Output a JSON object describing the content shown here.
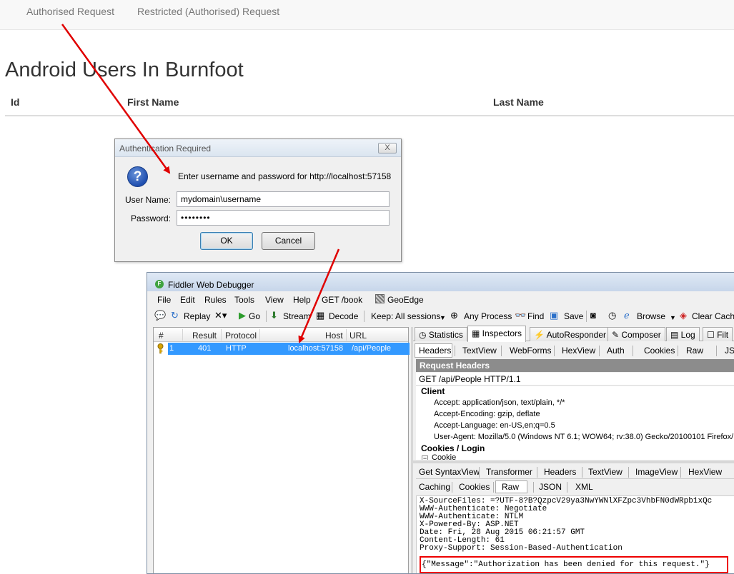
{
  "web": {
    "nav_links": [
      "Authorised Request",
      "Restricted (Authorised) Request"
    ],
    "page_title": "Android Users In Burnfoot",
    "table_headers": [
      "Id",
      "First Name",
      "Last Name"
    ]
  },
  "dialog": {
    "title": "Authentication Required",
    "close_label": "X",
    "prompt": "Enter username and password for http://localhost:57158",
    "username_label": "User Name:",
    "username_value": "mydomain\\username",
    "password_label": "Password:",
    "password_value": "••••••••",
    "ok_label": "OK",
    "cancel_label": "Cancel"
  },
  "fiddler": {
    "title": "Fiddler Web Debugger",
    "menu": [
      "File",
      "Edit",
      "Rules",
      "Tools",
      "View",
      "Help",
      "GET /book",
      "GeoEdge"
    ],
    "toolbar": {
      "replay": "Replay",
      "go": "Go",
      "stream": "Stream",
      "decode": "Decode",
      "keep": "Keep: All sessions",
      "any_process": "Any Process",
      "find": "Find",
      "save": "Save",
      "browse": "Browse",
      "clear_cache": "Clear Cach"
    },
    "session_columns": [
      "#",
      "Result",
      "Protocol",
      "Host",
      "URL"
    ],
    "sessions": [
      {
        "num": "1",
        "result": "401",
        "protocol": "HTTP",
        "host": "localhost:57158",
        "url": "/api/People"
      }
    ],
    "inspector_tabs": [
      "Statistics",
      "Inspectors",
      "AutoResponder",
      "Composer",
      "Log",
      "Filt"
    ],
    "request_tabs": [
      "Headers",
      "TextView",
      "WebForms",
      "HexView",
      "Auth",
      "Cookies",
      "Raw",
      "JS"
    ],
    "request_headers_title": "Request Headers",
    "request_line": "GET /api/People HTTP/1.1",
    "client_group": "Client",
    "client_headers": [
      "Accept: application/json, text/plain, */*",
      "Accept-Encoding: gzip, deflate",
      "Accept-Language: en-US,en;q=0.5",
      "User-Agent: Mozilla/5.0 (Windows NT 6.1; WOW64; rv:38.0) Gecko/20100101 Firefox/"
    ],
    "cookies_group": "Cookies / Login",
    "cookie_item": "Cookie",
    "response_tabs_row1": [
      "Get SyntaxView",
      "Transformer",
      "Headers",
      "TextView",
      "ImageView",
      "HexView"
    ],
    "response_tabs_row2": [
      "Caching",
      "Cookies",
      "Raw",
      "JSON",
      "XML"
    ],
    "response_lines": [
      "X-SourceFiles: =?UTF-8?B?QzpcV29ya3NwYWNlXFZpc3VhbFN0dWRpb1xQc",
      "WWW-Authenticate: Negotiate",
      "WWW-Authenticate: NTLM",
      "X-Powered-By: ASP.NET",
      "Date: Fri, 28 Aug 2015 06:21:57 GMT",
      "Content-Length: 61",
      "Proxy-Support: Session-Based-Authentication"
    ],
    "response_body": "{\"Message\":\"Authorization has been denied for this request.\"}"
  },
  "colors": {
    "selection": "#3399ff",
    "annotation": "#e00000"
  }
}
